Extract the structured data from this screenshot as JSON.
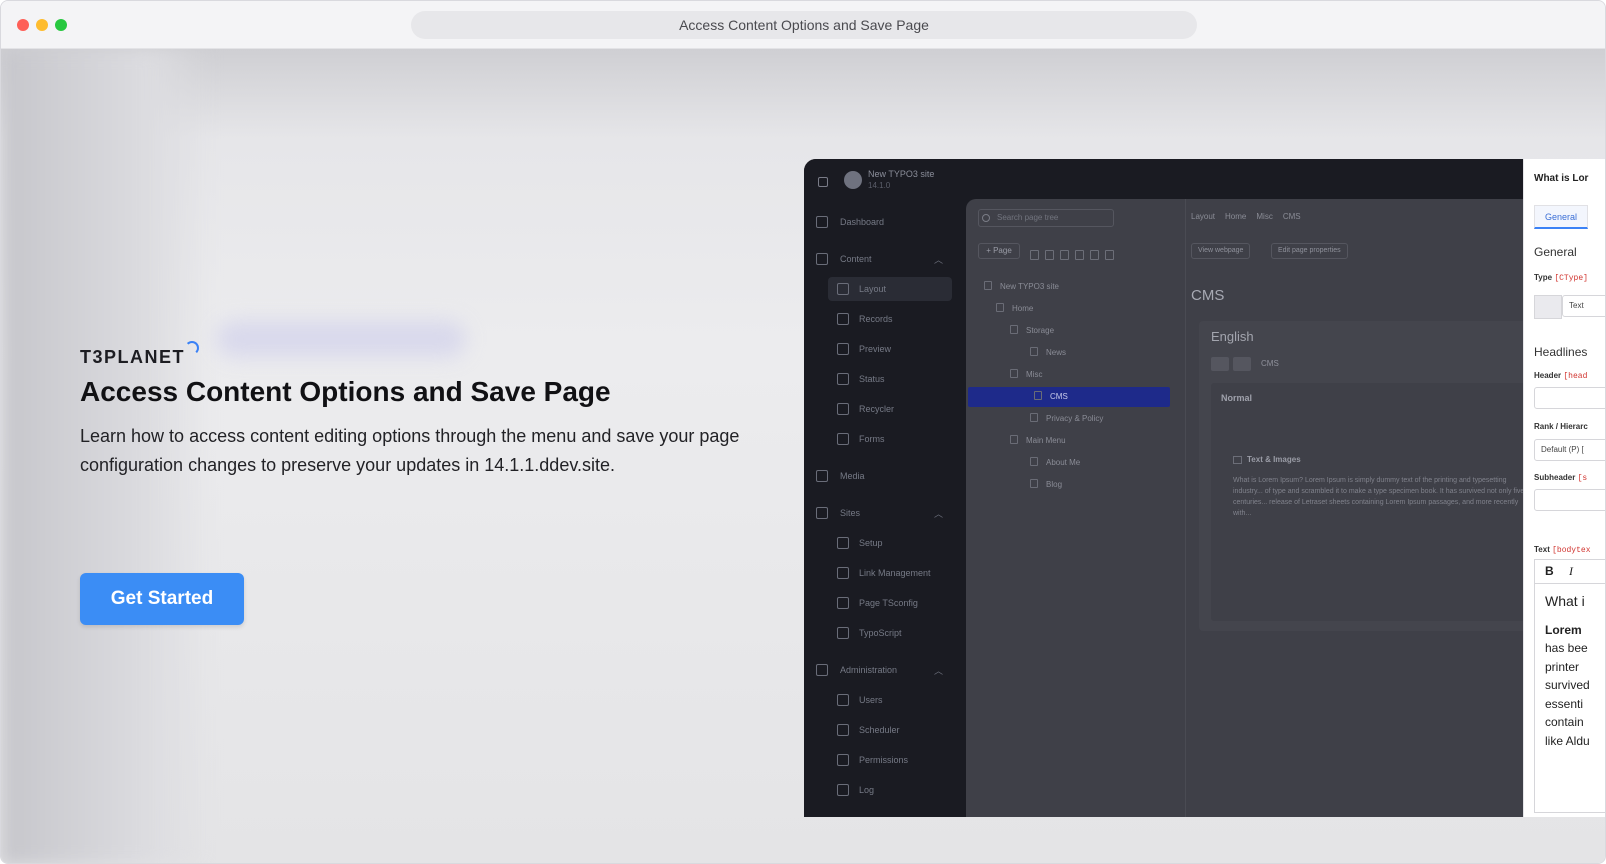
{
  "window": {
    "title": "Access Content Options and Save Page"
  },
  "hero": {
    "brand": "T3PLANET",
    "title": "Access Content Options and Save Page",
    "description": "Learn how to access content editing options through the menu and save your page configuration changes to preserve your updates in 14.1.1.ddev.site.",
    "cta_label": "Get Started"
  },
  "typo3": {
    "site_name": "New TYPO3 site",
    "version": "14.1.0",
    "sidebar": {
      "dashboard": "Dashboard",
      "content": "Content",
      "content_items": [
        "Layout",
        "Records",
        "Preview",
        "Status",
        "Recycler",
        "Forms"
      ],
      "media": "Media",
      "sites": "Sites",
      "sites_items": [
        "Setup",
        "Link Management",
        "Page TSconfig",
        "TypoScript"
      ],
      "administration": "Administration",
      "admin_items": [
        "Users",
        "Scheduler",
        "Permissions",
        "Log"
      ]
    },
    "tree": {
      "search_placeholder": "Search page tree",
      "new_page": "+ Page",
      "rows": [
        "New TYPO3 site",
        "Home",
        "Storage",
        "News",
        "Misc",
        "CMS",
        "Privacy & Policy",
        "Main Menu",
        "About Me",
        "Blog"
      ]
    },
    "breadcrumb": [
      "Layout",
      "Home",
      "Misc",
      "CMS"
    ],
    "buttons": {
      "view_webpage": "View webpage",
      "edit_page_properties": "Edit page properties"
    },
    "page_heading": "CMS",
    "language": "English",
    "lang_page": "CMS",
    "column": "Normal",
    "content_element": {
      "title": "Text & Images",
      "body": "What is Lorem Ipsum? Lorem Ipsum is simply dummy text of the printing and typesetting industry... of type and scrambled it to make a type specimen book. It has survived not only five centuries... release of Letraset sheets containing Lorem Ipsum passages, and more recently with..."
    }
  },
  "editor": {
    "title": "What is Lor",
    "tab": "General",
    "section_general": "General",
    "type_label": "Type",
    "type_code": "[CType]",
    "type_value": "Text",
    "section_headlines": "Headlines",
    "header_label": "Header",
    "header_code": "[head",
    "rank_label": "Rank / Hierarc",
    "rank_value": "Default (P) [",
    "subheader_label": "Subheader",
    "subheader_code": "[s",
    "text_label": "Text",
    "text_code": "[bodytex",
    "rte_bold": "B",
    "rte_italic": "I",
    "rte_lines": [
      "What i",
      "Lorem",
      "has bee",
      "printer",
      "survived",
      "essenti",
      "contain",
      "like Aldu"
    ]
  }
}
